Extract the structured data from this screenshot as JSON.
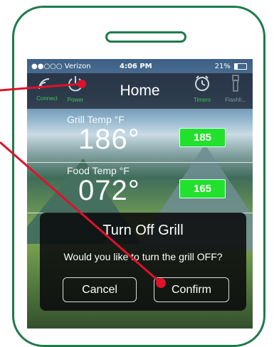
{
  "status": {
    "carrier": "●●○○○ Verizon",
    "time": "4:06 PM",
    "battery": "21%"
  },
  "nav": {
    "title": "Home",
    "connect_label": "Connect",
    "power_label": "Power",
    "timers_label": "Timers",
    "flashlight_label": "Flashli..."
  },
  "grill": {
    "label": "Grill Temp °F",
    "value": "186°",
    "setpoint": "185"
  },
  "food": {
    "label": "Food Temp °F",
    "value": "072°",
    "setpoint": "165"
  },
  "dialog": {
    "title": "Turn Off Grill",
    "message": "Would you like to turn the grill OFF?",
    "cancel_label": "Cancel",
    "confirm_label": "Confirm"
  },
  "colors": {
    "phone_outline": "#1f7a4b",
    "annotation": "#e0112b",
    "setpoint_green": "#22e12c",
    "active_label": "#3ac64b"
  },
  "icons": [
    "connect-icon",
    "power-icon",
    "timer-icon",
    "flashlight-icon"
  ]
}
